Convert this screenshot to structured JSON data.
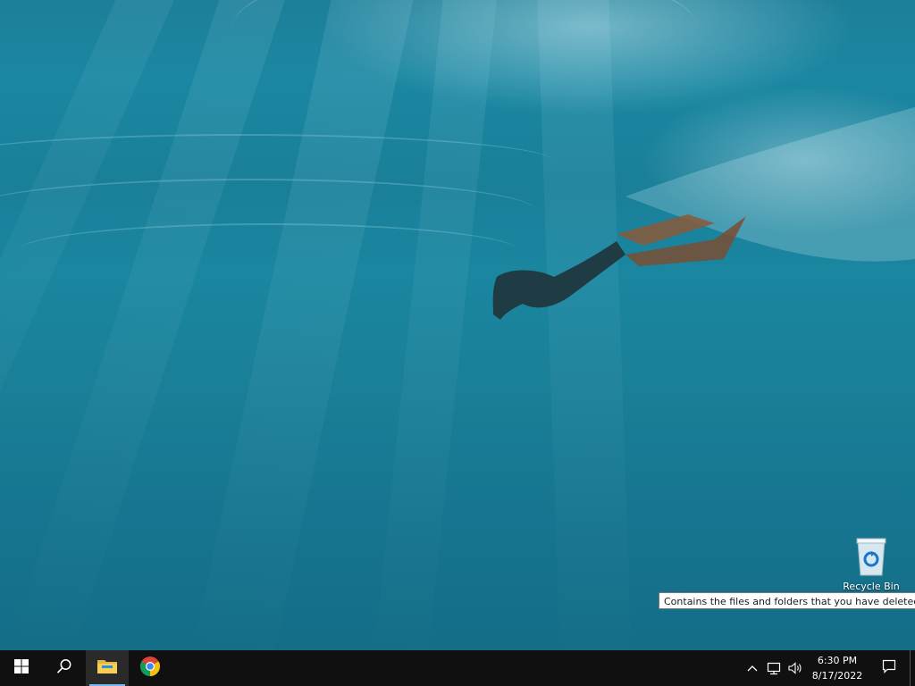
{
  "desktop": {
    "icons": [
      {
        "label": "Recycle Bin",
        "icon": "recycle-bin-icon"
      }
    ],
    "tooltip": "Contains the files and folders that you have deleted."
  },
  "taskbar": {
    "start": {
      "icon": "windows-logo-icon"
    },
    "search": {
      "icon": "search-icon"
    },
    "pinned": [
      {
        "name": "File Explorer",
        "icon": "file-explorer-icon",
        "active": true
      },
      {
        "name": "Google Chrome",
        "icon": "chrome-icon",
        "active": false
      }
    ],
    "tray": {
      "icons": [
        "chevron-up-icon",
        "network-icon",
        "volume-icon"
      ],
      "time": "6:30 PM",
      "date": "8/17/2022",
      "notification_icon": "action-center-icon"
    },
    "accent_color": "#76b9ed"
  }
}
